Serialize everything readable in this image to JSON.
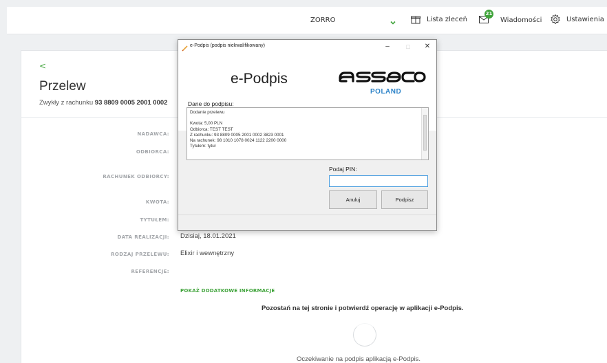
{
  "header": {
    "account_name": "ZORRO",
    "orders_label": "Lista zleceń",
    "messages_label": "Wiadomości",
    "messages_badge": "21",
    "settings_label": "Ustawienia"
  },
  "page": {
    "back_symbol": "<",
    "title": "Przelew",
    "subtitle_prefix": "Zwykły z rachunku",
    "subtitle_account": "93 8809 0005 2001 0002"
  },
  "details": {
    "nadawca_label": "NADAWCA:",
    "odbiorca_label": "ODBIORCA:",
    "rachunek_label": "RACHUNEK ODBIORCY:",
    "kwota_label": "KWOTA:",
    "tytulem_label": "TYTUŁEM:",
    "data_label": "DATA REALIZACJI:",
    "data_value": "Dzisiaj, 18.01.2021",
    "rodzaj_label": "RODZAJ PRZELEWU:",
    "rodzaj_value": "Elixir i wewnętrzny",
    "referencje_label": "REFERENCJE:"
  },
  "show_more_label": "POKAŻ DODATKOWE INFORMACJE",
  "confirm_message": "Pozostań na tej stronie i potwierdź operację w aplikacji e-Podpis.",
  "waiting_message": "Oczekiwanie na podpis aplikacją e-Podpis.",
  "dialog": {
    "window_title": "e-Podpis (podpis niekwalifikowany)",
    "heading": "e-Podpis",
    "brand_sub": "POLAND",
    "data_label": "Dane do podpisu:",
    "signing_text": "Dodanie przelewu\n\nKwota: 5,00 PLN\nOdbiorca: TEST TEST\nZ rachunku: 93 8809 0005 2001 0002 3823 0001\nNa rachunek: 98 1010 1078 0024 1122 2200 0000\nTytułem: tytuł",
    "pin_label": "Podaj PIN:",
    "pin_value": "",
    "cancel_label": "Anuluj",
    "sign_label": "Podpisz"
  },
  "colors": {
    "accent_green": "#3fa33a",
    "asseco_blue": "#2c83c8",
    "focus_blue": "#4d9fe0"
  }
}
